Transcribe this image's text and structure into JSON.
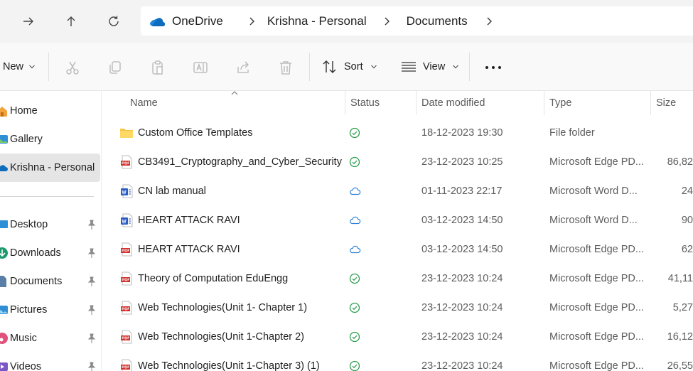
{
  "breadcrumb": [
    "OneDrive",
    "Krishna - Personal",
    "Documents"
  ],
  "toolbar": {
    "new_label": "New",
    "sort_label": "Sort",
    "view_label": "View"
  },
  "sidebar": {
    "items": [
      {
        "label": "Home",
        "icon": "home-icon"
      },
      {
        "label": "Gallery",
        "icon": "gallery-icon"
      },
      {
        "label": "Krishna - Personal",
        "icon": "onedrive-icon",
        "active": true
      }
    ],
    "pinned": [
      {
        "label": "Desktop",
        "icon": "desktop-icon"
      },
      {
        "label": "Downloads",
        "icon": "downloads-icon"
      },
      {
        "label": "Documents",
        "icon": "documents-icon"
      },
      {
        "label": "Pictures",
        "icon": "pictures-icon"
      },
      {
        "label": "Music",
        "icon": "music-icon"
      },
      {
        "label": "Videos",
        "icon": "videos-icon"
      }
    ]
  },
  "columns": {
    "name": "Name",
    "status": "Status",
    "date": "Date modified",
    "type": "Type",
    "size": "Size"
  },
  "files": [
    {
      "name": "Custom Office Templates",
      "kind": "folder",
      "status": "synced",
      "date": "18-12-2023 19:30",
      "type": "File folder",
      "size": ""
    },
    {
      "name": "CB3491_Cryptography_and_Cyber_Security",
      "kind": "pdf",
      "status": "synced",
      "date": "23-12-2023 10:25",
      "type": "Microsoft Edge PD...",
      "size": "86,82"
    },
    {
      "name": "CN lab manual",
      "kind": "word",
      "status": "cloud",
      "date": "01-11-2023 22:17",
      "type": "Microsoft Word D...",
      "size": "24"
    },
    {
      "name": "HEART ATTACK RAVI",
      "kind": "word",
      "status": "cloud",
      "date": "03-12-2023 14:50",
      "type": "Microsoft Word D...",
      "size": "90"
    },
    {
      "name": "HEART ATTACK RAVI",
      "kind": "pdf",
      "status": "cloud",
      "date": "03-12-2023 14:50",
      "type": "Microsoft Edge PD...",
      "size": "62"
    },
    {
      "name": "Theory of Computation EduEngg",
      "kind": "pdf",
      "status": "synced",
      "date": "23-12-2023 10:24",
      "type": "Microsoft Edge PD...",
      "size": "41,11"
    },
    {
      "name": "Web Technologies(Unit 1- Chapter 1)",
      "kind": "pdf",
      "status": "synced",
      "date": "23-12-2023 10:24",
      "type": "Microsoft Edge PD...",
      "size": "5,27"
    },
    {
      "name": "Web Technologies(Unit 1-Chapter 2)",
      "kind": "pdf",
      "status": "synced",
      "date": "23-12-2023 10:24",
      "type": "Microsoft Edge PD...",
      "size": "16,12"
    },
    {
      "name": "Web Technologies(Unit 1-Chapter 3) (1)",
      "kind": "pdf",
      "status": "synced",
      "date": "23-12-2023 10:24",
      "type": "Microsoft Edge PD...",
      "size": "26,55"
    }
  ],
  "colors": {
    "synced": "#2e9e4f",
    "cloud": "#2d7fd3",
    "pdf": "#d1312b",
    "word": "#2b5cc4",
    "folder": "#f6c344",
    "onedrive": "#0f6cbd"
  }
}
